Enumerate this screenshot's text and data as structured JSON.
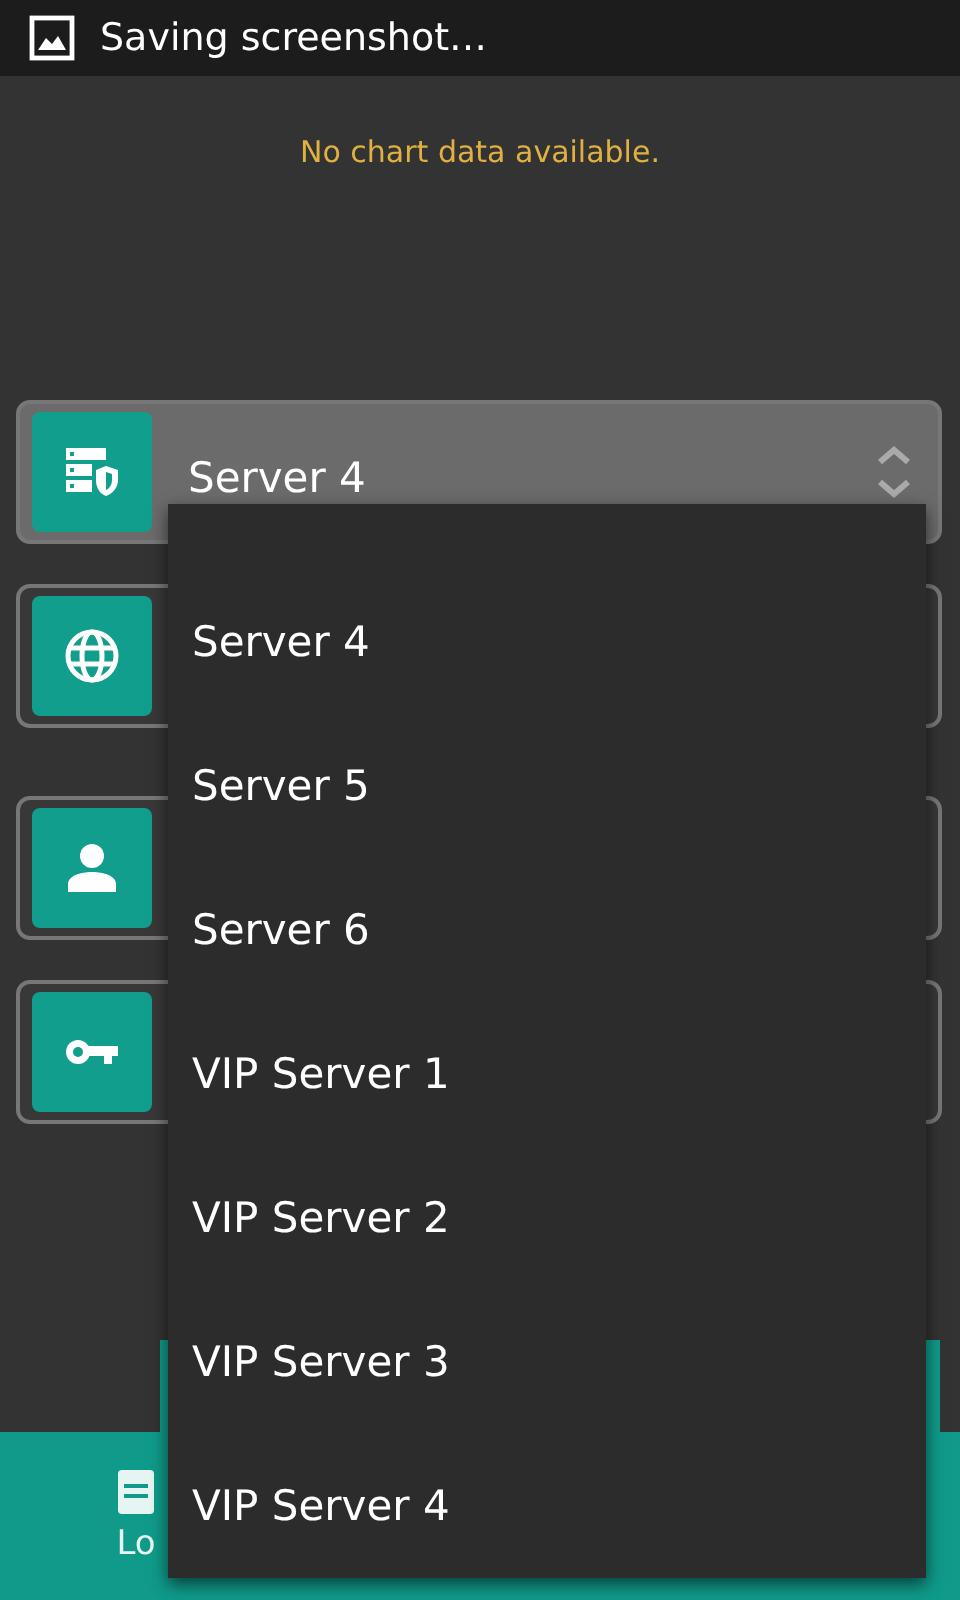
{
  "status_bar": {
    "notification": "Saving screenshot…"
  },
  "chart": {
    "message": "No chart data available."
  },
  "fields": [
    {
      "kind": "server",
      "value": "Server 4",
      "expanded": true
    },
    {
      "kind": "globe",
      "expanded": false
    },
    {
      "kind": "person",
      "expanded": false
    },
    {
      "kind": "key",
      "expanded": false
    }
  ],
  "dropdown": {
    "items": [
      {
        "label": "Server 4",
        "selected": false
      },
      {
        "label": "Server 5",
        "selected": false
      },
      {
        "label": "Server 6",
        "selected": false
      },
      {
        "label": "VIP Server 1",
        "selected": false
      },
      {
        "label": "VIP Server 2",
        "selected": false
      },
      {
        "label": "VIP Server 3",
        "selected": false
      },
      {
        "label": "VIP Server 4",
        "selected": false
      }
    ]
  },
  "bottom_nav": [
    {
      "kind": "log",
      "label": "Lo"
    }
  ]
}
